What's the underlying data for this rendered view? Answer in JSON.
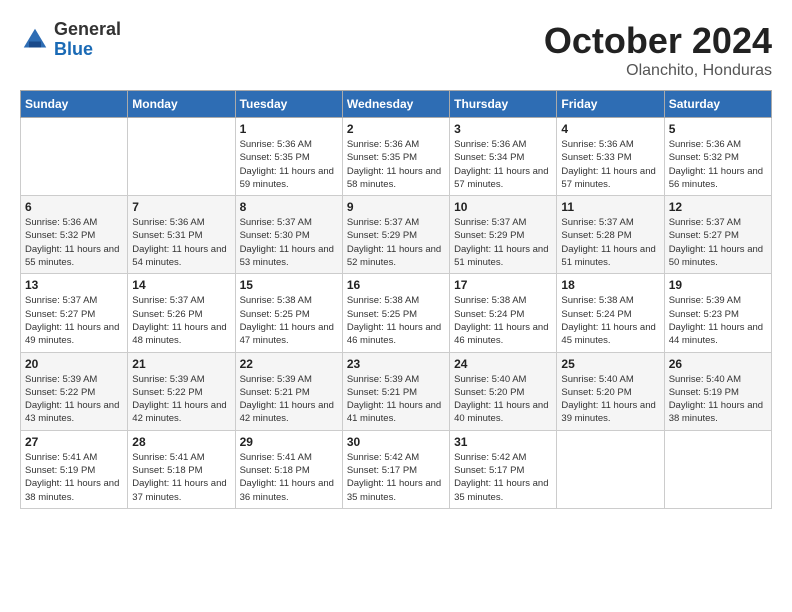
{
  "logo": {
    "general": "General",
    "blue": "Blue"
  },
  "title": "October 2024",
  "location": "Olanchito, Honduras",
  "days_header": [
    "Sunday",
    "Monday",
    "Tuesday",
    "Wednesday",
    "Thursday",
    "Friday",
    "Saturday"
  ],
  "weeks": [
    [
      {
        "day": "",
        "info": ""
      },
      {
        "day": "",
        "info": ""
      },
      {
        "day": "1",
        "info": "Sunrise: 5:36 AM\nSunset: 5:35 PM\nDaylight: 11 hours and 59 minutes."
      },
      {
        "day": "2",
        "info": "Sunrise: 5:36 AM\nSunset: 5:35 PM\nDaylight: 11 hours and 58 minutes."
      },
      {
        "day": "3",
        "info": "Sunrise: 5:36 AM\nSunset: 5:34 PM\nDaylight: 11 hours and 57 minutes."
      },
      {
        "day": "4",
        "info": "Sunrise: 5:36 AM\nSunset: 5:33 PM\nDaylight: 11 hours and 57 minutes."
      },
      {
        "day": "5",
        "info": "Sunrise: 5:36 AM\nSunset: 5:32 PM\nDaylight: 11 hours and 56 minutes."
      }
    ],
    [
      {
        "day": "6",
        "info": "Sunrise: 5:36 AM\nSunset: 5:32 PM\nDaylight: 11 hours and 55 minutes."
      },
      {
        "day": "7",
        "info": "Sunrise: 5:36 AM\nSunset: 5:31 PM\nDaylight: 11 hours and 54 minutes."
      },
      {
        "day": "8",
        "info": "Sunrise: 5:37 AM\nSunset: 5:30 PM\nDaylight: 11 hours and 53 minutes."
      },
      {
        "day": "9",
        "info": "Sunrise: 5:37 AM\nSunset: 5:29 PM\nDaylight: 11 hours and 52 minutes."
      },
      {
        "day": "10",
        "info": "Sunrise: 5:37 AM\nSunset: 5:29 PM\nDaylight: 11 hours and 51 minutes."
      },
      {
        "day": "11",
        "info": "Sunrise: 5:37 AM\nSunset: 5:28 PM\nDaylight: 11 hours and 51 minutes."
      },
      {
        "day": "12",
        "info": "Sunrise: 5:37 AM\nSunset: 5:27 PM\nDaylight: 11 hours and 50 minutes."
      }
    ],
    [
      {
        "day": "13",
        "info": "Sunrise: 5:37 AM\nSunset: 5:27 PM\nDaylight: 11 hours and 49 minutes."
      },
      {
        "day": "14",
        "info": "Sunrise: 5:37 AM\nSunset: 5:26 PM\nDaylight: 11 hours and 48 minutes."
      },
      {
        "day": "15",
        "info": "Sunrise: 5:38 AM\nSunset: 5:25 PM\nDaylight: 11 hours and 47 minutes."
      },
      {
        "day": "16",
        "info": "Sunrise: 5:38 AM\nSunset: 5:25 PM\nDaylight: 11 hours and 46 minutes."
      },
      {
        "day": "17",
        "info": "Sunrise: 5:38 AM\nSunset: 5:24 PM\nDaylight: 11 hours and 46 minutes."
      },
      {
        "day": "18",
        "info": "Sunrise: 5:38 AM\nSunset: 5:24 PM\nDaylight: 11 hours and 45 minutes."
      },
      {
        "day": "19",
        "info": "Sunrise: 5:39 AM\nSunset: 5:23 PM\nDaylight: 11 hours and 44 minutes."
      }
    ],
    [
      {
        "day": "20",
        "info": "Sunrise: 5:39 AM\nSunset: 5:22 PM\nDaylight: 11 hours and 43 minutes."
      },
      {
        "day": "21",
        "info": "Sunrise: 5:39 AM\nSunset: 5:22 PM\nDaylight: 11 hours and 42 minutes."
      },
      {
        "day": "22",
        "info": "Sunrise: 5:39 AM\nSunset: 5:21 PM\nDaylight: 11 hours and 42 minutes."
      },
      {
        "day": "23",
        "info": "Sunrise: 5:39 AM\nSunset: 5:21 PM\nDaylight: 11 hours and 41 minutes."
      },
      {
        "day": "24",
        "info": "Sunrise: 5:40 AM\nSunset: 5:20 PM\nDaylight: 11 hours and 40 minutes."
      },
      {
        "day": "25",
        "info": "Sunrise: 5:40 AM\nSunset: 5:20 PM\nDaylight: 11 hours and 39 minutes."
      },
      {
        "day": "26",
        "info": "Sunrise: 5:40 AM\nSunset: 5:19 PM\nDaylight: 11 hours and 38 minutes."
      }
    ],
    [
      {
        "day": "27",
        "info": "Sunrise: 5:41 AM\nSunset: 5:19 PM\nDaylight: 11 hours and 38 minutes."
      },
      {
        "day": "28",
        "info": "Sunrise: 5:41 AM\nSunset: 5:18 PM\nDaylight: 11 hours and 37 minutes."
      },
      {
        "day": "29",
        "info": "Sunrise: 5:41 AM\nSunset: 5:18 PM\nDaylight: 11 hours and 36 minutes."
      },
      {
        "day": "30",
        "info": "Sunrise: 5:42 AM\nSunset: 5:17 PM\nDaylight: 11 hours and 35 minutes."
      },
      {
        "day": "31",
        "info": "Sunrise: 5:42 AM\nSunset: 5:17 PM\nDaylight: 11 hours and 35 minutes."
      },
      {
        "day": "",
        "info": ""
      },
      {
        "day": "",
        "info": ""
      }
    ]
  ]
}
